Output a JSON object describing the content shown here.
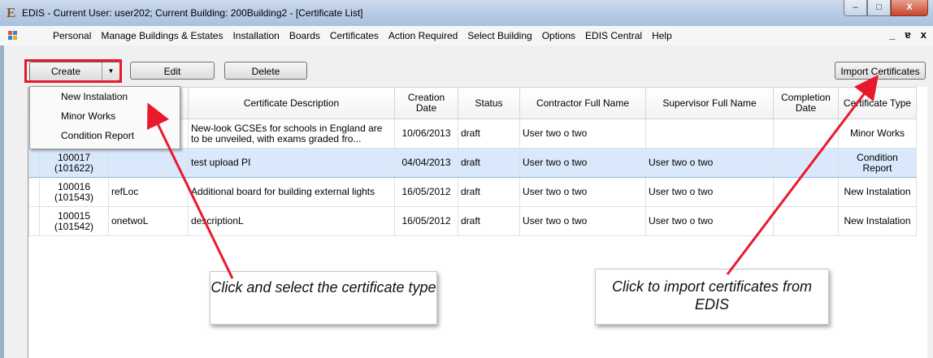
{
  "window": {
    "app_icon": "E",
    "title": "EDIS  - Current User: user202;  Current Building: 200Building2 - [Certificate List]",
    "minimize": "–",
    "maximize": "□",
    "close": "X"
  },
  "menu": {
    "items": [
      "Personal",
      "Manage Buildings & Estates",
      "Installation",
      "Boards",
      "Certificates",
      "Action Required",
      "Select Building",
      "Options",
      "EDIS Central",
      "Help"
    ],
    "mdi_minimize": "_",
    "mdi_restore": "ɐ",
    "mdi_close": "x"
  },
  "toolbar": {
    "create_label": "Create",
    "create_arrow": "▼",
    "edit_label": "Edit",
    "delete_label": "Delete",
    "import_label": "Import Certificates"
  },
  "dropdown": {
    "items": [
      "New Instalation",
      "Minor Works",
      "Condition Report"
    ]
  },
  "table": {
    "headers": [
      "",
      "",
      "Certificate Description",
      "Creation Date",
      "Status",
      "Contractor Full Name",
      "Supervisor Full Name",
      "Completion Date",
      "Certificate Type"
    ],
    "rows": [
      [
        "",
        "",
        "New-look GCSEs for schools in England are to be unveiled, with exams graded fro...",
        "10/06/2013",
        "draft",
        "User two o two",
        "",
        "",
        "Minor Works"
      ],
      [
        "100017 (101622)",
        "",
        "test upload PI",
        "04/04/2013",
        "draft",
        "User two o two",
        "User two o two",
        "",
        "Condition Report"
      ],
      [
        "100016 (101543)",
        "refLoc",
        "Additional board for building external lights",
        "16/05/2012",
        "draft",
        "User two o two",
        "User two o two",
        "",
        "New Instalation"
      ],
      [
        "100015 (101542)",
        "onetwoL",
        "descriptionL",
        "16/05/2012",
        "draft",
        "User two o two",
        "User two o two",
        "",
        "New Instalation"
      ]
    ]
  },
  "callouts": {
    "left": "Click and select the certificate type",
    "right": "Click to import certificates from EDIS"
  },
  "colors": {
    "highlight": "#e8192c",
    "selected_row": "#d9e8fb"
  }
}
